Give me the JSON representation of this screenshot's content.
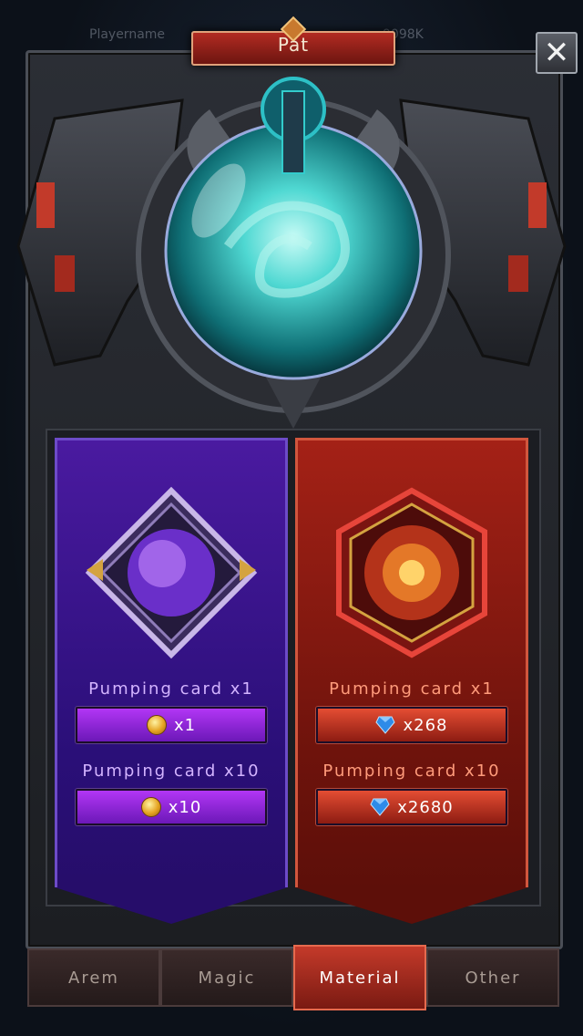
{
  "header": {
    "ghost_left": "Playername",
    "ghost_right": "9098K",
    "title": "Pat"
  },
  "close_label": "✕",
  "cards": {
    "purple": {
      "single_label": "Pumping card x1",
      "single_cost": "x1",
      "ten_label": "Pumping card x10",
      "ten_cost": "x10",
      "currency": "gold-coin-icon"
    },
    "red": {
      "single_label": "Pumping card x1",
      "single_cost": "x268",
      "ten_label": "Pumping card x10",
      "ten_cost": "x2680",
      "currency": "diamond-icon"
    }
  },
  "tabs": [
    {
      "label": "Arem"
    },
    {
      "label": "Magic"
    },
    {
      "label": "Material"
    },
    {
      "label": "Other"
    }
  ],
  "active_tab": "Material",
  "colors": {
    "purple_banner": "#4a1aa0",
    "red_banner": "#a42116",
    "orb": "#3fd1d1"
  }
}
